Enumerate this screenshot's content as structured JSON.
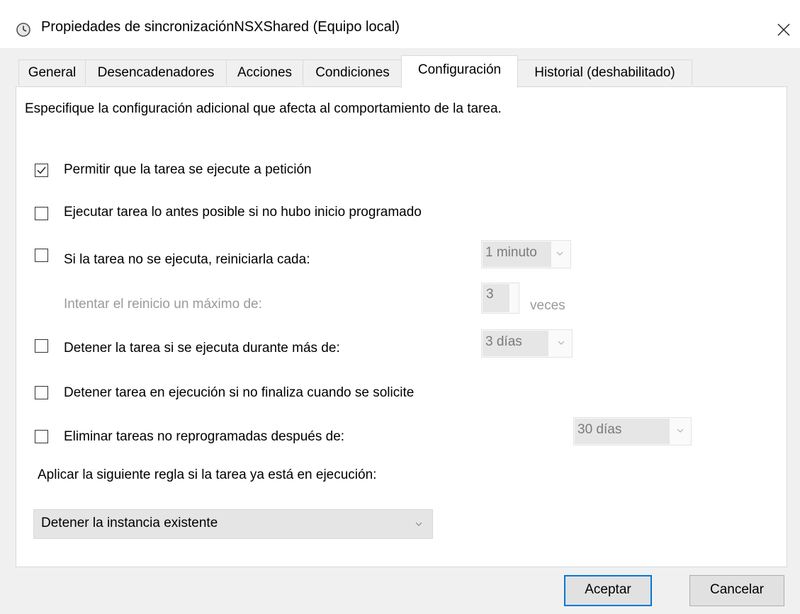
{
  "window": {
    "title": "Propiedades de sincronizaciónNSXShared (Equipo local)",
    "icon": "clock-icon",
    "close_icon": "close-icon"
  },
  "tabs": [
    {
      "label": "General",
      "active": false
    },
    {
      "label": "Desencadenadores",
      "active": false
    },
    {
      "label": "Acciones",
      "active": false
    },
    {
      "label": "Condiciones",
      "active": false
    },
    {
      "label": "Configuración",
      "active": true
    },
    {
      "label": "Historial (deshabilitado)",
      "active": false
    }
  ],
  "settings": {
    "description": "Especifique la configuración adicional que afecta al comportamiento de la tarea.",
    "options": [
      {
        "label": "Permitir que la tarea se ejecute a petición",
        "checked": true
      },
      {
        "label": "Ejecutar tarea lo antes posible si no hubo inicio programado",
        "checked": false
      },
      {
        "label": "Si la tarea no se ejecuta, reiniciarla cada:",
        "checked": false
      },
      {
        "label": "Detener la tarea si se ejecuta durante más de:",
        "checked": false
      },
      {
        "label": "Detener tarea en ejecución si no finaliza cuando se solicite",
        "checked": false
      },
      {
        "label": "Eliminar tareas no reprogramadas después de:",
        "checked": false
      }
    ],
    "restart_interval": "1 minuto",
    "restart_attempts_label": "Intentar el reinicio un máximo de:",
    "restart_attempts_value": "3",
    "restart_attempts_unit": "veces",
    "stop_after": "3 días",
    "delete_after": "30 días",
    "rule_label": "Aplicar la siguiente regla si la tarea ya está en ejecución:",
    "rule_value": "Detener la instancia existente"
  },
  "buttons": {
    "accept": "Aceptar",
    "cancel": "Cancelar"
  },
  "colors": {
    "focus_border": "#0078d7",
    "disabled_text": "#9a9a9a"
  }
}
